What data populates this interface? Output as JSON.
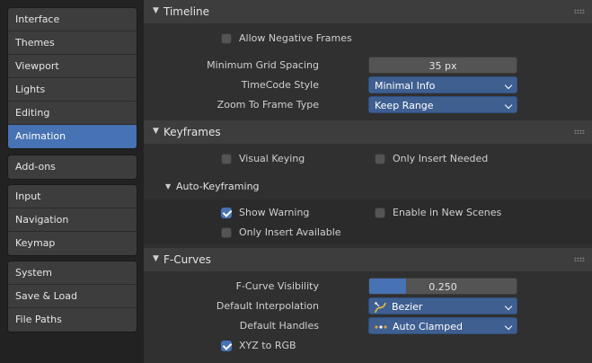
{
  "sidebar": {
    "groups": [
      [
        "Interface",
        "Themes",
        "Viewport",
        "Lights",
        "Editing",
        "Animation"
      ],
      [
        "Add-ons"
      ],
      [
        "Input",
        "Navigation",
        "Keymap"
      ],
      [
        "System",
        "Save & Load",
        "File Paths"
      ]
    ],
    "active": "Animation"
  },
  "timeline": {
    "title": "Timeline",
    "allow_negative_frames": {
      "label": "Allow Negative Frames",
      "checked": false
    },
    "min_grid_spacing": {
      "label": "Minimum Grid Spacing",
      "value": "35 px"
    },
    "timecode_style": {
      "label": "TimeCode Style",
      "value": "Minimal Info"
    },
    "zoom_to_frame_type": {
      "label": "Zoom To Frame Type",
      "value": "Keep Range"
    }
  },
  "keyframes": {
    "title": "Keyframes",
    "visual_keying": {
      "label": "Visual Keying",
      "checked": false
    },
    "only_insert_needed": {
      "label": "Only Insert Needed",
      "checked": false
    },
    "auto_keyframing": {
      "title": "Auto-Keyframing",
      "show_warning": {
        "label": "Show Warning",
        "checked": true
      },
      "enable_in_new_scenes": {
        "label": "Enable in New Scenes",
        "checked": false
      },
      "only_insert_available": {
        "label": "Only Insert Available",
        "checked": false
      }
    }
  },
  "fcurves": {
    "title": "F-Curves",
    "visibility": {
      "label": "F-Curve Visibility",
      "value": "0.250",
      "fraction": 0.25
    },
    "default_interpolation": {
      "label": "Default Interpolation",
      "value": "Bezier",
      "icon": "bezier-curve-icon"
    },
    "default_handles": {
      "label": "Default Handles",
      "value": "Auto Clamped",
      "icon": "handle-points-icon"
    },
    "xyz_to_rgb": {
      "label": "XYZ to RGB",
      "checked": true
    }
  },
  "colors": {
    "accent": "#4772b3",
    "dropdown": "#3f5f91",
    "background": "#303030"
  }
}
